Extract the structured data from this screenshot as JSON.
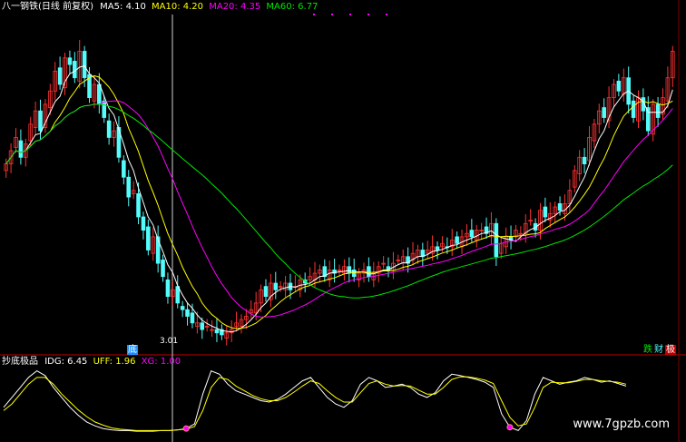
{
  "header": {
    "main": {
      "title": "八一钢铁(日线 前复权)",
      "ma5_label": "MA5:",
      "ma5": "4.10",
      "ma10_label": "MA10:",
      "ma10": "4.20",
      "ma20_label": "MA20:",
      "ma20": "4.35",
      "ma60_label": "MA60:",
      "ma60": "6.77"
    },
    "sub": {
      "title": "抄底极品",
      "idg_label": "IDG:",
      "idg": "6.45",
      "uff_label": "UFF:",
      "uff": "1.96",
      "xg_label": "XG:",
      "xg": "1.00"
    }
  },
  "annotations": {
    "low_price": "3.01",
    "badge_left": "底",
    "badge_right_1": "跌",
    "badge_right_2": "财",
    "badge_right_3": "极"
  },
  "watermark": "www.7gpzb.com",
  "colors": {
    "up": "#ff3232",
    "down": "#54fcfc",
    "ma5": "#ffffff",
    "ma10": "#ffff00",
    "ma20": "#ff00ff",
    "ma60": "#00e600",
    "separator": "#c00000",
    "idg": "#ffffff",
    "uff": "#ffff00",
    "xg": "#ff00ff"
  },
  "chart_data": [
    {
      "type": "candlestick",
      "title": "八一钢铁(日线 前复权)",
      "ylim": [
        2.8,
        7.8
      ],
      "series": [
        {
          "name": "MA5",
          "values_note": "computed"
        },
        {
          "name": "MA10"
        },
        {
          "name": "MA20"
        },
        {
          "name": "MA60"
        }
      ],
      "candles_close": [
        5.6,
        5.8,
        6.0,
        5.7,
        5.9,
        6.2,
        6.4,
        6.1,
        6.5,
        6.7,
        7.0,
        6.8,
        7.2,
        7.1,
        6.9,
        7.3,
        6.9,
        6.6,
        6.8,
        6.5,
        6.3,
        6.0,
        6.1,
        5.7,
        5.4,
        5.1,
        5.2,
        4.8,
        4.6,
        4.3,
        4.5,
        4.1,
        3.9,
        3.6,
        3.7,
        3.5,
        3.4,
        3.3,
        3.2,
        3.2,
        3.1,
        3.15,
        3.1,
        3.05,
        3.02,
        3.05,
        3.1,
        3.2,
        3.25,
        3.3,
        3.4,
        3.5,
        3.7,
        3.6,
        3.8,
        3.7,
        3.75,
        3.8,
        3.7,
        3.75,
        3.85,
        3.8,
        3.9,
        3.95,
        4.0,
        3.9,
        4.0,
        3.95,
        4.0,
        4.05,
        3.95,
        3.9,
        3.95,
        4.0,
        3.9,
        3.95,
        4.05,
        4.1,
        4.0,
        4.1,
        4.15,
        4.2,
        4.1,
        4.25,
        4.3,
        4.2,
        4.3,
        4.35,
        4.3,
        4.4,
        4.35,
        4.45,
        4.4,
        4.5,
        4.55,
        4.5,
        4.6,
        4.6,
        4.55,
        4.7,
        4.2,
        4.4,
        4.5,
        4.45,
        4.6,
        4.55,
        4.7,
        4.75,
        4.6,
        4.9,
        4.8,
        4.85,
        4.95,
        4.9,
        5.0,
        5.2,
        5.5,
        5.7,
        5.6,
        6.0,
        6.2,
        6.4,
        6.3,
        6.6,
        6.8,
        6.7,
        6.9,
        6.5,
        6.3,
        6.6,
        6.4,
        6.1,
        6.5,
        6.3,
        6.6,
        6.9,
        7.3
      ],
      "ma5": [
        5.55,
        5.7,
        5.8,
        5.8,
        5.85,
        5.95,
        6.1,
        6.2,
        6.3,
        6.4,
        6.6,
        6.8,
        6.9,
        7.0,
        7.0,
        7.05,
        7.0,
        6.9,
        6.85,
        6.7,
        6.55,
        6.35,
        6.2,
        6.0,
        5.8,
        5.5,
        5.3,
        5.1,
        4.9,
        4.7,
        4.5,
        4.35,
        4.15,
        3.95,
        3.8,
        3.65,
        3.55,
        3.45,
        3.35,
        3.28,
        3.22,
        3.18,
        3.15,
        3.12,
        3.1,
        3.08,
        3.08,
        3.1,
        3.15,
        3.2,
        3.28,
        3.35,
        3.45,
        3.5,
        3.6,
        3.66,
        3.7,
        3.73,
        3.74,
        3.75,
        3.78,
        3.8,
        3.83,
        3.87,
        3.9,
        3.92,
        3.95,
        3.97,
        3.98,
        4.0,
        3.99,
        3.97,
        3.96,
        3.96,
        3.94,
        3.95,
        3.97,
        4.0,
        4.03,
        4.07,
        4.1,
        4.13,
        4.15,
        4.18,
        4.22,
        4.24,
        4.27,
        4.29,
        4.3,
        4.33,
        4.36,
        4.39,
        4.42,
        4.46,
        4.48,
        4.52,
        4.55,
        4.57,
        4.59,
        4.6,
        4.5,
        4.47,
        4.46,
        4.44,
        4.45,
        4.52,
        4.59,
        4.63,
        4.65,
        4.71,
        4.76,
        4.8,
        4.84,
        4.88,
        4.92,
        5.0,
        5.12,
        5.27,
        5.4,
        5.56,
        5.75,
        5.98,
        6.14,
        6.3,
        6.46,
        6.56,
        6.66,
        6.62,
        6.56,
        6.52,
        6.46,
        6.4,
        6.38,
        6.38,
        6.44,
        6.56,
        6.78
      ]
    },
    {
      "type": "line",
      "title": "抄底极品",
      "series": [
        {
          "name": "IDG",
          "values": [
            40,
            55,
            70,
            85,
            95,
            88,
            70,
            55,
            40,
            28,
            18,
            12,
            8,
            6,
            5,
            5,
            4,
            4,
            4,
            5,
            5,
            6,
            8,
            15,
            60,
            95,
            90,
            75,
            65,
            60,
            55,
            50,
            48,
            52,
            60,
            70,
            80,
            85,
            70,
            55,
            45,
            40,
            50,
            75,
            85,
            80,
            70,
            72,
            75,
            70,
            60,
            55,
            62,
            80,
            90,
            88,
            85,
            82,
            78,
            70,
            30,
            10,
            5,
            20,
            60,
            85,
            80,
            75,
            78,
            80,
            85,
            82,
            78,
            80,
            76,
            72
          ]
        },
        {
          "name": "UFF",
          "values": [
            35,
            45,
            60,
            75,
            85,
            85,
            75,
            60,
            48,
            36,
            26,
            18,
            13,
            9,
            7,
            6,
            5,
            5,
            5,
            5,
            5,
            6,
            7,
            11,
            35,
            70,
            85,
            82,
            72,
            65,
            58,
            53,
            50,
            50,
            55,
            63,
            72,
            80,
            76,
            65,
            55,
            48,
            48,
            62,
            76,
            80,
            75,
            72,
            73,
            72,
            66,
            60,
            60,
            70,
            82,
            86,
            86,
            84,
            81,
            76,
            50,
            25,
            12,
            15,
            40,
            70,
            78,
            77,
            77,
            79,
            82,
            82,
            80,
            79,
            78,
            75
          ]
        }
      ],
      "xg_signals": [
        22,
        61
      ]
    }
  ]
}
